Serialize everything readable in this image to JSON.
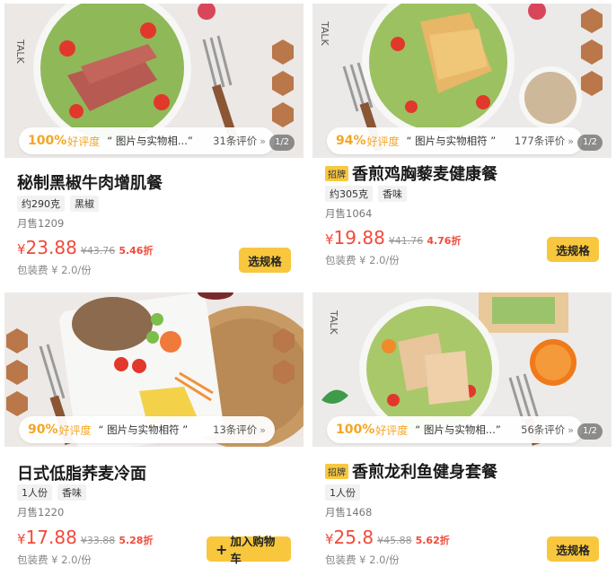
{
  "cards": [
    {
      "good_percent": "100%",
      "good_label": "好评度",
      "quote": "“ 图片与实物相...”",
      "reviews": "31条评价",
      "pager": "1/2",
      "badge": "",
      "title": "秘制黑椒牛肉增肌餐",
      "tags": [
        "约290克",
        "黑椒"
      ],
      "monthly": "月售1209",
      "currency": "¥",
      "price": "23.88",
      "original_price": "¥43.76",
      "discount": "5.46折",
      "packing_fee": "包装费 ¥ 2.0/份",
      "button": "选规格",
      "button_icon": ""
    },
    {
      "good_percent": "94%",
      "good_label": "好评度",
      "quote": "“ 图片与实物相符 ”",
      "reviews": "177条评价",
      "pager": "1/2",
      "badge": "招牌",
      "title": "香煎鸡胸藜麦健康餐",
      "tags": [
        "约305克",
        "香味"
      ],
      "monthly": "月售1064",
      "currency": "¥",
      "price": "19.88",
      "original_price": "¥41.76",
      "discount": "4.76折",
      "packing_fee": "包装费 ¥ 2.0/份",
      "button": "选规格",
      "button_icon": ""
    },
    {
      "good_percent": "90%",
      "good_label": "好评度",
      "quote": "“ 图片与实物相符 ”",
      "reviews": "13条评价",
      "pager": "",
      "badge": "",
      "title": "日式低脂荞麦冷面",
      "tags": [
        "1人份",
        "香味"
      ],
      "monthly": "月售1220",
      "currency": "¥",
      "price": "17.88",
      "original_price": "¥33.88",
      "discount": "5.28折",
      "packing_fee": "包装费 ¥ 2.0/份",
      "button": "加入购物车",
      "button_icon": "+"
    },
    {
      "good_percent": "100%",
      "good_label": "好评度",
      "quote": "“ 图片与实物相...”",
      "reviews": "56条评价",
      "pager": "1/2",
      "badge": "招牌",
      "title": "香煎龙利鱼健身套餐",
      "tags": [
        "1人份"
      ],
      "monthly": "月售1468",
      "currency": "¥",
      "price": "25.8",
      "original_price": "¥45.88",
      "discount": "5.62折",
      "packing_fee": "包装费 ¥ 2.0/份",
      "button": "选规格",
      "button_icon": ""
    }
  ],
  "colors": {
    "accent_orange": "#f5a623",
    "price_red": "#f04a3a",
    "button_yellow": "#f8c73d",
    "badge_yellow": "#f7c842"
  },
  "icons": {
    "chevron": "chevron-down-icon",
    "plus": "plus-icon"
  },
  "photo_watermark": "TALK"
}
